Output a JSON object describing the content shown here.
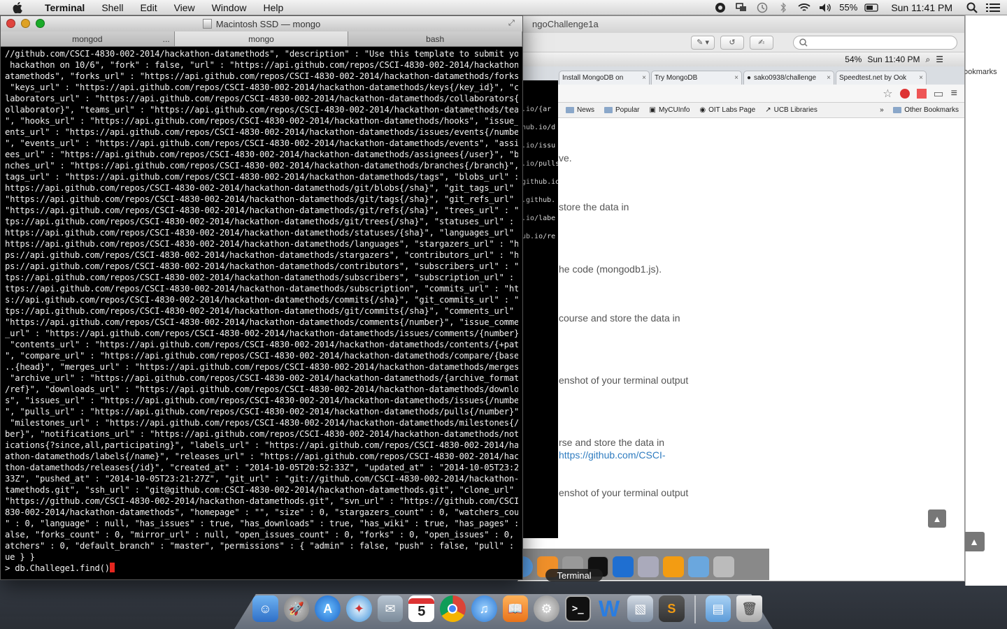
{
  "menubar": {
    "app": "Terminal",
    "items": [
      "Shell",
      "Edit",
      "View",
      "Window",
      "Help"
    ],
    "battery": "55%",
    "clock": "Sun 11:41 PM"
  },
  "browser": {
    "title_fragment": "ngoChallenge1a",
    "inner_battery": "54%",
    "inner_clock": "Sun 11:40 PM",
    "tabs": [
      {
        "label": "Install MongoDB on"
      },
      {
        "label": "Try MongoDB"
      },
      {
        "label": "sako0938/challenge"
      },
      {
        "label": "Speedtest.net by Ook"
      }
    ],
    "bookmarks": [
      "News",
      "Popular",
      "MyCUInfo",
      "OIT Labs Page",
      "UCB Libraries"
    ],
    "other_bookmarks": "Other Bookmarks",
    "bookmarks_sidebar": "ookmarks",
    "page_lines": [
      "ve.",
      "store the data in",
      "he code (mongodb1.js).",
      "course and store the data in",
      "enshot of your terminal output",
      "rse and store the data in",
      "https://github.com/CSCI-",
      "enshot of your terminal output"
    ]
  },
  "bg_terminal_lines": [
    ".io/{ar",
    "hub.io/d",
    ".io/issu",
    ".io/pulls",
    "github.io/",
    ".github.",
    ".io/labe",
    "ub.io/re"
  ],
  "terminal": {
    "title": "Macintosh SSD — mongo",
    "tabs": [
      "mongod",
      "mongo",
      "bash"
    ],
    "lines": [
      "//github.com/CSCI-4830-002-2014/hackathon-datamethods\", \"description\" : \"Use this template to submit your",
      " hackathon on 10/6\", \"fork\" : false, \"url\" : \"https://api.github.com/repos/CSCI-4830-002-2014/hackathon-d",
      "atamethods\", \"forks_url\" : \"https://api.github.com/repos/CSCI-4830-002-2014/hackathon-datamethods/forks\",",
      " \"keys_url\" : \"https://api.github.com/repos/CSCI-4830-002-2014/hackathon-datamethods/keys{/key_id}\", \"col",
      "laborators_url\" : \"https://api.github.com/repos/CSCI-4830-002-2014/hackathon-datamethods/collaborators{/c",
      "ollaborator}\", \"teams_url\" : \"https://api.github.com/repos/CSCI-4830-002-2014/hackathon-datamethods/teams",
      "\", \"hooks_url\" : \"https://api.github.com/repos/CSCI-4830-002-2014/hackathon-datamethods/hooks\", \"issue_ev",
      "ents_url\" : \"https://api.github.com/repos/CSCI-4830-002-2014/hackathon-datamethods/issues/events{/number}",
      "\", \"events_url\" : \"https://api.github.com/repos/CSCI-4830-002-2014/hackathon-datamethods/events\", \"assign",
      "ees_url\" : \"https://api.github.com/repos/CSCI-4830-002-2014/hackathon-datamethods/assignees{/user}\", \"bra",
      "nches_url\" : \"https://api.github.com/repos/CSCI-4830-002-2014/hackathon-datamethods/branches{/branch}\", \"",
      "tags_url\" : \"https://api.github.com/repos/CSCI-4830-002-2014/hackathon-datamethods/tags\", \"blobs_url\" : \"",
      "https://api.github.com/repos/CSCI-4830-002-2014/hackathon-datamethods/git/blobs{/sha}\", \"git_tags_url\" :",
      "\"https://api.github.com/repos/CSCI-4830-002-2014/hackathon-datamethods/git/tags{/sha}\", \"git_refs_url\" :",
      "\"https://api.github.com/repos/CSCI-4830-002-2014/hackathon-datamethods/git/refs{/sha}\", \"trees_url\" : \"ht",
      "tps://api.github.com/repos/CSCI-4830-002-2014/hackathon-datamethods/git/trees{/sha}\", \"statuses_url\" : \"",
      "https://api.github.com/repos/CSCI-4830-002-2014/hackathon-datamethods/statuses/{sha}\", \"languages_url\" : \"",
      "https://api.github.com/repos/CSCI-4830-002-2014/hackathon-datamethods/languages\", \"stargazers_url\" : \"htt",
      "ps://api.github.com/repos/CSCI-4830-002-2014/hackathon-datamethods/stargazers\", \"contributors_url\" : \"htt",
      "ps://api.github.com/repos/CSCI-4830-002-2014/hackathon-datamethods/contributors\", \"subscribers_url\" : \"ht",
      "tps://api.github.com/repos/CSCI-4830-002-2014/hackathon-datamethods/subscribers\", \"subscription_url\" : \"h",
      "ttps://api.github.com/repos/CSCI-4830-002-2014/hackathon-datamethods/subscription\", \"commits_url\" : \"http",
      "s://api.github.com/repos/CSCI-4830-002-2014/hackathon-datamethods/commits{/sha}\", \"git_commits_url\" : \"ht",
      "tps://api.github.com/repos/CSCI-4830-002-2014/hackathon-datamethods/git/commits{/sha}\", \"comments_url\" :",
      "\"https://api.github.com/repos/CSCI-4830-002-2014/hackathon-datamethods/comments{/number}\", \"issue_comment",
      "_url\" : \"https://api.github.com/repos/CSCI-4830-002-2014/hackathon-datamethods/issues/comments/{number}\",",
      " \"contents_url\" : \"https://api.github.com/repos/CSCI-4830-002-2014/hackathon-datamethods/contents/{+path}",
      "\", \"compare_url\" : \"https://api.github.com/repos/CSCI-4830-002-2014/hackathon-datamethods/compare/{base}.",
      "..{head}\", \"merges_url\" : \"https://api.github.com/repos/CSCI-4830-002-2014/hackathon-datamethods/merges\",",
      " \"archive_url\" : \"https://api.github.com/repos/CSCI-4830-002-2014/hackathon-datamethods/{archive_format}{",
      "/ref}\", \"downloads_url\" : \"https://api.github.com/repos/CSCI-4830-002-2014/hackathon-datamethods/download",
      "s\", \"issues_url\" : \"https://api.github.com/repos/CSCI-4830-002-2014/hackathon-datamethods/issues{/number}",
      "\", \"pulls_url\" : \"https://api.github.com/repos/CSCI-4830-002-2014/hackathon-datamethods/pulls{/number}\",",
      " \"milestones_url\" : \"https://api.github.com/repos/CSCI-4830-002-2014/hackathon-datamethods/milestones{/num",
      "ber}\", \"notifications_url\" : \"https://api.github.com/repos/CSCI-4830-002-2014/hackathon-datamethods/notif",
      "ications{?since,all,participating}\", \"labels_url\" : \"https://api.github.com/repos/CSCI-4830-002-2014/hack",
      "athon-datamethods/labels{/name}\", \"releases_url\" : \"https://api.github.com/repos/CSCI-4830-002-2014/hacka",
      "thon-datamethods/releases{/id}\", \"created_at\" : \"2014-10-05T20:52:33Z\", \"updated_at\" : \"2014-10-05T23:24:",
      "33Z\", \"pushed_at\" : \"2014-10-05T23:21:27Z\", \"git_url\" : \"git://github.com/CSCI-4830-002-2014/hackathon-da",
      "tamethods.git\", \"ssh_url\" : \"git@github.com:CSCI-4830-002-2014/hackathon-datamethods.git\", \"clone_url\" :",
      "\"https://github.com/CSCI-4830-002-2014/hackathon-datamethods.git\", \"svn_url\" : \"https://github.com/CSCI-4",
      "830-002-2014/hackathon-datamethods\", \"homepage\" : \"\", \"size\" : 0, \"stargazers_count\" : 0, \"watchers_count",
      "\" : 0, \"language\" : null, \"has_issues\" : true, \"has_downloads\" : true, \"has_wiki\" : true, \"has_pages\" : f",
      "alse, \"forks_count\" : 0, \"mirror_url\" : null, \"open_issues_count\" : 0, \"forks\" : 0, \"open_issues\" : 0, \"w",
      "atchers\" : 0, \"default_branch\" : \"master\", \"permissions\" : { \"admin\" : false, \"push\" : false, \"pull\" : tr",
      "ue } }"
    ],
    "prompt": "> db.Challege1.find()"
  },
  "dock": {
    "terminal_label": "Terminal",
    "calendar_day": "5",
    "icons": [
      "finder",
      "launchpad",
      "app-store",
      "safari",
      "preview",
      "calendar",
      "chrome",
      "itunes",
      "ibooks",
      "system-preferences",
      "terminal",
      "word",
      "iphoto",
      "sublime-text",
      "documents",
      "trash"
    ]
  },
  "colors": {
    "terminal_bg": "#000000",
    "terminal_fg": "#f2f2f2",
    "cursor": "#e5261f",
    "link": "#2f7cc0"
  }
}
